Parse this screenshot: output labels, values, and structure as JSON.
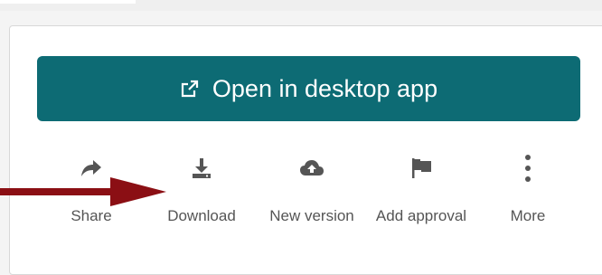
{
  "open_button": {
    "label": "Open in desktop app",
    "icon": "external-link-icon",
    "color": "#0d6b74"
  },
  "actions": [
    {
      "label": "Share",
      "icon": "share-icon"
    },
    {
      "label": "Download",
      "icon": "download-icon"
    },
    {
      "label": "New version",
      "icon": "cloud-upload-icon"
    },
    {
      "label": "Add approval",
      "icon": "flag-icon"
    },
    {
      "label": "More",
      "icon": "more-vertical-icon"
    }
  ],
  "annotation": {
    "arrow_color": "#8b0f14"
  }
}
